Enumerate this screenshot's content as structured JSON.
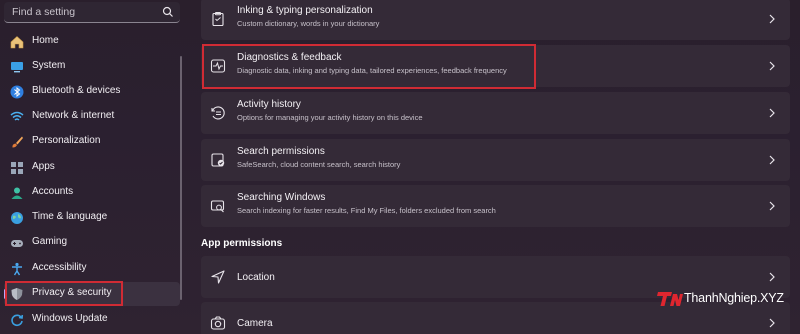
{
  "search": {
    "placeholder": "Find a setting"
  },
  "sidebar": {
    "items": [
      {
        "label": "Home",
        "icon": "home-icon"
      },
      {
        "label": "System",
        "icon": "system-icon"
      },
      {
        "label": "Bluetooth & devices",
        "icon": "bluetooth-icon"
      },
      {
        "label": "Network & internet",
        "icon": "wifi-icon"
      },
      {
        "label": "Personalization",
        "icon": "brush-icon"
      },
      {
        "label": "Apps",
        "icon": "apps-icon"
      },
      {
        "label": "Accounts",
        "icon": "accounts-icon"
      },
      {
        "label": "Time & language",
        "icon": "globe-icon"
      },
      {
        "label": "Gaming",
        "icon": "gamepad-icon"
      },
      {
        "label": "Accessibility",
        "icon": "accessibility-icon"
      },
      {
        "label": "Privacy & security",
        "icon": "shield-icon",
        "active": true
      },
      {
        "label": "Windows Update",
        "icon": "update-icon"
      }
    ]
  },
  "main": {
    "cards": [
      {
        "title": "Inking & typing personalization",
        "subtitle": "Custom dictionary, words in your dictionary",
        "icon": "clipboard-icon"
      },
      {
        "title": "Diagnostics & feedback",
        "subtitle": "Diagnostic data, inking and typing data, tailored experiences, feedback frequency",
        "icon": "diagnostics-icon",
        "highlighted": true
      },
      {
        "title": "Activity history",
        "subtitle": "Options for managing your activity history on this device",
        "icon": "history-icon"
      },
      {
        "title": "Search permissions",
        "subtitle": "SafeSearch, cloud content search, search history",
        "icon": "search-permissions-icon"
      },
      {
        "title": "Searching Windows",
        "subtitle": "Search indexing for faster results, Find My Files, folders excluded from search",
        "icon": "searching-windows-icon"
      }
    ],
    "section_title": "App permissions",
    "app_permissions": [
      {
        "title": "Location",
        "icon": "location-icon"
      },
      {
        "title": "Camera",
        "icon": "camera-icon"
      }
    ]
  },
  "watermark": {
    "text": "ThanhNghiep.XYZ",
    "logo": "TN"
  },
  "colors": {
    "highlight": "#d02b34",
    "accent": "#c1a6f5",
    "background": "#2a1f2c",
    "card": "#342a37"
  }
}
